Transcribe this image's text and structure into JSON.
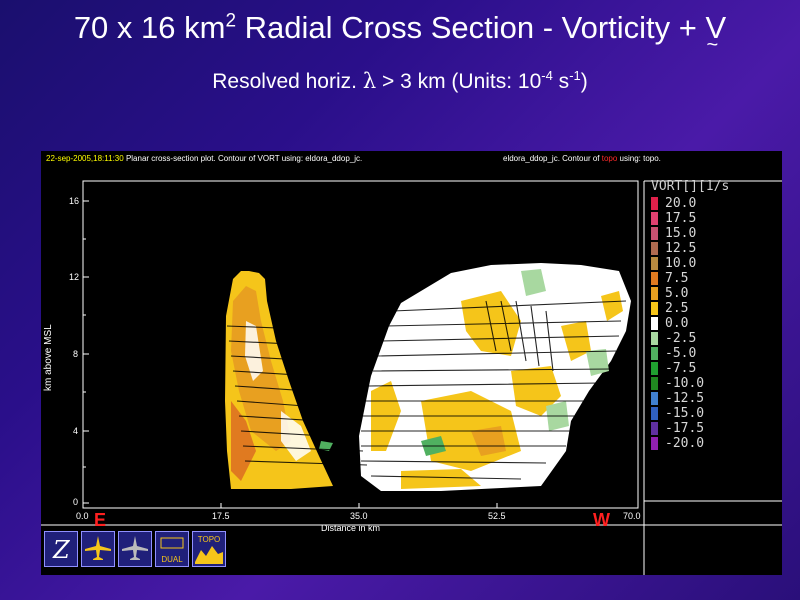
{
  "title": {
    "prefix": "70 x 16 km",
    "sup": "2",
    "middle": " Radial Cross Section - Vorticity + ",
    "v": "V",
    "tilde": "~"
  },
  "subtitle": {
    "a": "Resolved horiz. ",
    "lambda": "λ",
    "b": " > 3 km (Units: 10",
    "sup1": "-4",
    "c": " s",
    "sup2": "-1",
    "d": ")"
  },
  "header": {
    "date": "22-sep-2005,18:11:30",
    "left_text": "Planar cross-section plot.  Contour of VORT using: eldora_ddop_jc.",
    "right_a": "eldora_ddop_jc.  Contour of ",
    "right_topo": "topo",
    "right_b": " using: topo."
  },
  "axes": {
    "ylabel": "km above MSL",
    "xlabel": "Distance in km",
    "yticks": [
      "16",
      "12",
      "8",
      "4",
      "0"
    ],
    "xticks": [
      "0.0",
      "17.5",
      "35.0",
      "52.5",
      "70.0"
    ],
    "left_dir": "E",
    "right_dir": "W"
  },
  "legend": {
    "title": "VORT[][1/s",
    "items": [
      {
        "label": "20.0",
        "color": "#e0204a"
      },
      {
        "label": "17.5",
        "color": "#e04070"
      },
      {
        "label": "15.0",
        "color": "#c85070"
      },
      {
        "label": "12.5",
        "color": "#b06a50"
      },
      {
        "label": "10.0",
        "color": "#b88a40"
      },
      {
        "label": "7.5",
        "color": "#e07a20"
      },
      {
        "label": "5.0",
        "color": "#e8a020"
      },
      {
        "label": "2.5",
        "color": "#f5c51a"
      },
      {
        "label": "0.0",
        "color": "#ffffff"
      },
      {
        "label": "-2.5",
        "color": "#a8d8a0"
      },
      {
        "label": "-5.0",
        "color": "#50b060"
      },
      {
        "label": "-7.5",
        "color": "#20a030"
      },
      {
        "label": "-10.0",
        "color": "#208820"
      },
      {
        "label": "-12.5",
        "color": "#4080d0"
      },
      {
        "label": "-15.0",
        "color": "#3060c0"
      },
      {
        "label": "-17.5",
        "color": "#6030a0"
      },
      {
        "label": "-20.0",
        "color": "#9020b0"
      }
    ]
  },
  "toolbar": {
    "zebra": "Z",
    "dual_nrl": "DUAL NRL",
    "dual": "DUAL",
    "nrl": "NRL",
    "topo": "TOPO"
  }
}
